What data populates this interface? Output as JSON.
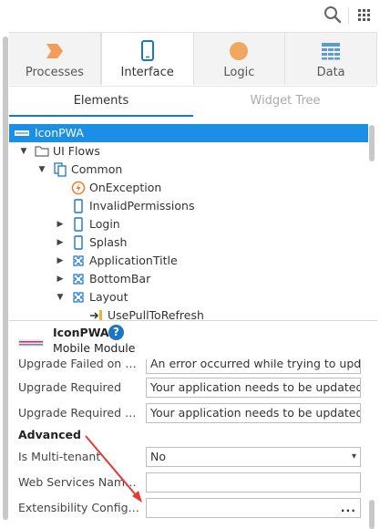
{
  "toolbar": {
    "search_icon": "search-icon",
    "apps_icon": "grid-icon"
  },
  "tabs": [
    {
      "label": "Processes",
      "icon": "processes-icon",
      "color": "#f39c5a"
    },
    {
      "label": "Interface",
      "icon": "mobile-icon",
      "color": "#1b76c8"
    },
    {
      "label": "Logic",
      "icon": "logic-icon",
      "color": "#f0a860"
    },
    {
      "label": "Data",
      "icon": "data-icon",
      "color": "#5b9bd5"
    }
  ],
  "subtabs": [
    {
      "label": "Elements"
    },
    {
      "label": "Widget Tree"
    }
  ],
  "tree": {
    "items": [
      {
        "label": "IconPWA",
        "icon": "module-icon"
      },
      {
        "label": "UI Flows",
        "icon": "folder-icon"
      },
      {
        "label": "Common",
        "icon": "flow-icon"
      },
      {
        "label": "OnException",
        "icon": "exception-icon"
      },
      {
        "label": "InvalidPermissions",
        "icon": "screen-icon"
      },
      {
        "label": "Login",
        "icon": "screen-icon"
      },
      {
        "label": "Splash",
        "icon": "screen-icon"
      },
      {
        "label": "ApplicationTitle",
        "icon": "block-icon"
      },
      {
        "label": "BottomBar",
        "icon": "block-icon"
      },
      {
        "label": "Layout",
        "icon": "block-icon"
      },
      {
        "label": "UsePullToRefresh",
        "icon": "input-param-icon"
      }
    ]
  },
  "properties": {
    "module_name": "IconPWA",
    "module_type": "Mobile Module",
    "help_glyph": "?",
    "rows": [
      {
        "label": "Upgrade Failed on Da...",
        "value": "An error occurred while trying to update"
      },
      {
        "label": "Upgrade Required",
        "value": "Your application needs to be updated. Ta"
      },
      {
        "label": "Upgrade Required wi...",
        "value": "Your application needs to be updated. U"
      }
    ],
    "section_advanced": "Advanced",
    "advanced_rows": [
      {
        "label": "Is Multi-tenant",
        "value": "No"
      },
      {
        "label": "Web Services Names...",
        "value": ""
      },
      {
        "label": "Extensibility Configur...",
        "value": "..."
      }
    ]
  },
  "colors": {
    "accent": "#1b76c8",
    "selection": "#1b8ee6",
    "annotation_arrow": "#e53935"
  }
}
